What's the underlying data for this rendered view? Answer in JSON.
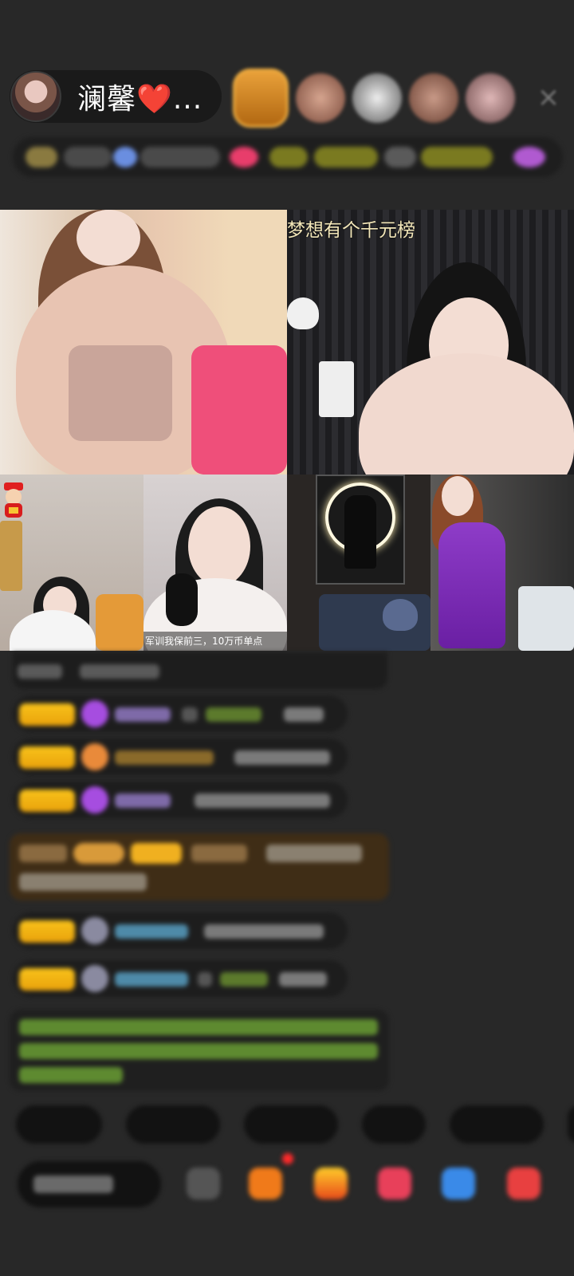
{
  "host": {
    "name": "澜馨",
    "heart": "❤️",
    "ellipsis": "..."
  },
  "viewers": [
    "viewer-1",
    "viewer-2",
    "viewer-3",
    "viewer-4",
    "viewer-5"
  ],
  "close_icon": "×",
  "tiles": {
    "top_right_caption": "梦想有个千元榜",
    "bottom_caption": "军训我保前三，10万币单点"
  },
  "colors": {
    "background": "#282828",
    "badge_gold": "#f8c21a",
    "gift_gem": "#a64de0",
    "chat_link": "#6fb8d8",
    "chat_green": "#7fbf3f"
  }
}
